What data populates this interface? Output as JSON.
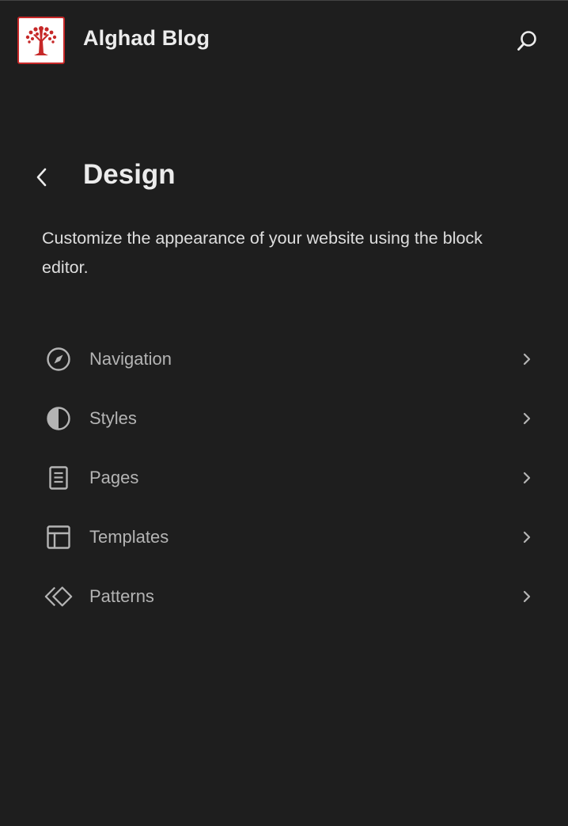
{
  "header": {
    "site_title": "Alghad Blog",
    "logo_icon": "tree-logo-icon",
    "search_icon": "search-icon"
  },
  "panel": {
    "back_icon": "chevron-left-icon",
    "title": "Design",
    "description": "Customize the appearance of your website using the block editor."
  },
  "nav": {
    "items": [
      {
        "label": "Navigation",
        "icon": "navigation-compass-icon"
      },
      {
        "label": "Styles",
        "icon": "styles-half-circle-icon"
      },
      {
        "label": "Pages",
        "icon": "page-icon"
      },
      {
        "label": "Templates",
        "icon": "layout-template-icon"
      },
      {
        "label": "Patterns",
        "icon": "symbol-diamond-icon"
      }
    ],
    "chevron_icon": "chevron-right-icon"
  },
  "colors": {
    "background": "#1e1e1e",
    "title_text": "#ececec",
    "menu_text": "#b4b4b4",
    "logo_red": "#c62828"
  }
}
